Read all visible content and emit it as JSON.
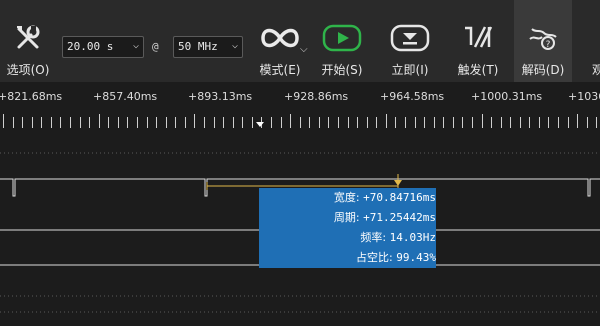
{
  "toolbar": {
    "options_label": "选项(O)",
    "duration_value": "20.00 s",
    "at_symbol": "@",
    "rate_value": "50 MHz",
    "mode_label": "模式(E)",
    "start_label": "开始(S)",
    "immediate_label": "立即(I)",
    "trigger_label": "触发(T)",
    "decode_label": "解码(D)",
    "next_label": "观"
  },
  "ruler": {
    "labels": [
      "+821.68ms",
      "+857.40ms",
      "+893.13ms",
      "+928.86ms",
      "+964.58ms",
      "+1000.31ms",
      "+1036"
    ]
  },
  "measurement": {
    "width_label": "宽度:",
    "width_value": "+70.84716ms",
    "period_label": "周期:",
    "period_value": "+71.25442ms",
    "freq_label": "频率:",
    "freq_value": "14.03Hz",
    "duty_label": "占空比:",
    "duty_value": "99.43%"
  },
  "colors": {
    "toolbar_bg": "#2a2a2a",
    "canvas_bg": "#1c1c1c",
    "start_green": "#2fb44a",
    "measure_blue": "#1f6fb5",
    "marker_yellow": "#e0b84a"
  },
  "icons": [
    "wrench-screwdriver-icon",
    "infinity-icon",
    "play-icon",
    "download-icon",
    "trigger-icon",
    "decode-icon"
  ]
}
